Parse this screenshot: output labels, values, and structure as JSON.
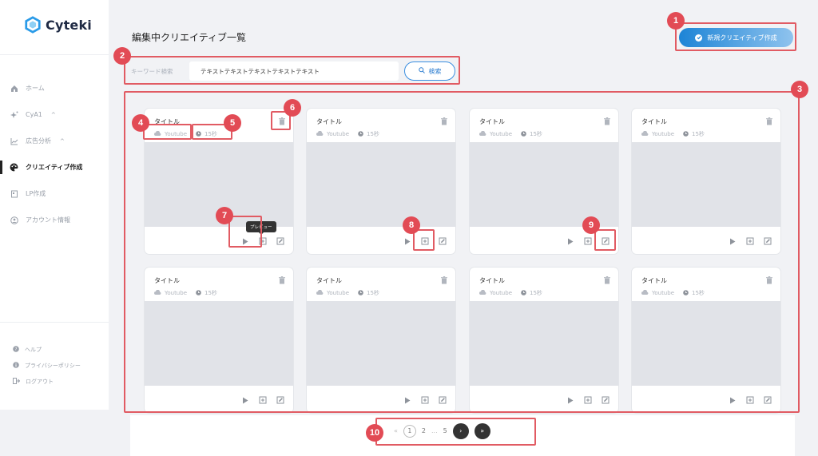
{
  "brand": {
    "name": "Cyteki"
  },
  "sidebar": {
    "items": [
      {
        "label": "ホーム",
        "icon": "home-icon",
        "chevron": ""
      },
      {
        "label": "CyA1",
        "icon": "sparkle-icon",
        "chevron": "^"
      },
      {
        "label": "広告分析",
        "icon": "chart-icon",
        "chevron": "^"
      },
      {
        "label": "クリエイティブ作成",
        "icon": "palette-icon",
        "chevron": ""
      },
      {
        "label": "LP作成",
        "icon": "document-icon",
        "chevron": ""
      },
      {
        "label": "アカウント情報",
        "icon": "user-icon",
        "chevron": ""
      }
    ],
    "active_index": 3,
    "footer": [
      {
        "label": "ヘルプ",
        "icon": "help-icon"
      },
      {
        "label": "プライバシーポリシー",
        "icon": "info-icon"
      },
      {
        "label": "ログアウト",
        "icon": "logout-icon"
      }
    ]
  },
  "main": {
    "title": "編集中クリエイティブ一覧",
    "new_button": "新規クリエイティブ作成",
    "search": {
      "label": "キーワード検索",
      "value": "テキストテキストテキストテキストテキスト",
      "button": "検索"
    },
    "cards": [
      {
        "title": "タイトル",
        "platform": "Youtube",
        "duration": "15秒"
      },
      {
        "title": "タイトル",
        "platform": "Youtube",
        "duration": "15秒"
      },
      {
        "title": "タイトル",
        "platform": "Youtube",
        "duration": "15秒"
      },
      {
        "title": "タイトル",
        "platform": "Youtube",
        "duration": "15秒"
      },
      {
        "title": "タイトル",
        "platform": "Youtube",
        "duration": "15秒"
      },
      {
        "title": "タイトル",
        "platform": "Youtube",
        "duration": "15秒"
      },
      {
        "title": "タイトル",
        "platform": "Youtube",
        "duration": "15秒"
      },
      {
        "title": "タイトル",
        "platform": "Youtube",
        "duration": "15秒"
      }
    ],
    "tooltip": "プレビュー",
    "pagination": {
      "first": "«",
      "current": "1",
      "page2": "2",
      "ellipsis": "...",
      "last_page": "5",
      "next": "›",
      "last": "»"
    }
  },
  "annotations": [
    "1",
    "2",
    "3",
    "4",
    "5",
    "6",
    "7",
    "8",
    "9",
    "10"
  ],
  "colors": {
    "annotation": "#e24b55",
    "accent": "#1d84d6",
    "sidebar_active": "#222222"
  }
}
